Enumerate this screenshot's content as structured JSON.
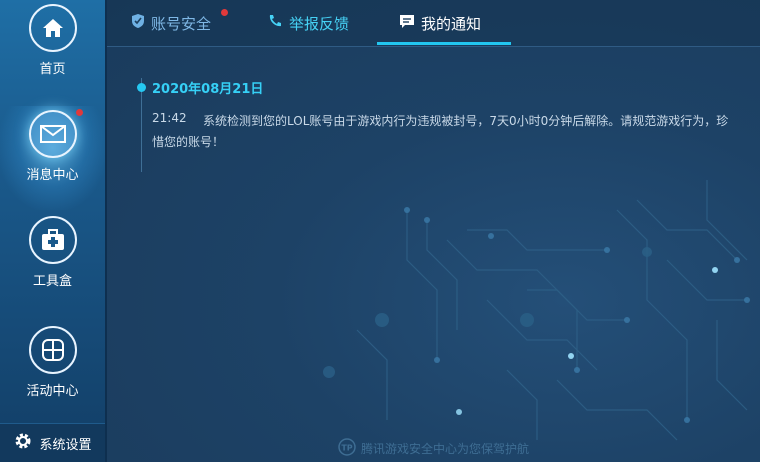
{
  "sidebar": {
    "items": [
      {
        "label": "首页",
        "icon": "home-icon"
      },
      {
        "label": "消息中心",
        "icon": "mail-icon",
        "active": true,
        "badge": true
      },
      {
        "label": "工具盒",
        "icon": "toolbox-icon"
      },
      {
        "label": "活动中心",
        "icon": "grid-icon"
      }
    ],
    "settings_label": "系统设置"
  },
  "tabs": [
    {
      "label": "账号安全",
      "icon": "shield-icon",
      "badge": true
    },
    {
      "label": "举报反馈",
      "icon": "phone-icon"
    },
    {
      "label": "我的通知",
      "icon": "message-icon",
      "active": true
    }
  ],
  "notification": {
    "date": "2020年08月21日",
    "time": "21:42",
    "text": "系统检测到您的LOL账号由于游戏内行为违规被封号，7天0小时0分钟后解除。请规范游戏行为，珍惜您的账号！"
  },
  "footer": {
    "text": "腾讯游戏安全中心为您保驾护航",
    "logo": "tp-logo"
  },
  "colors": {
    "accent": "#22c6f0",
    "sidebar": "#1a5a8c",
    "badge": "#e0393b",
    "background": "#1d3f5e"
  }
}
